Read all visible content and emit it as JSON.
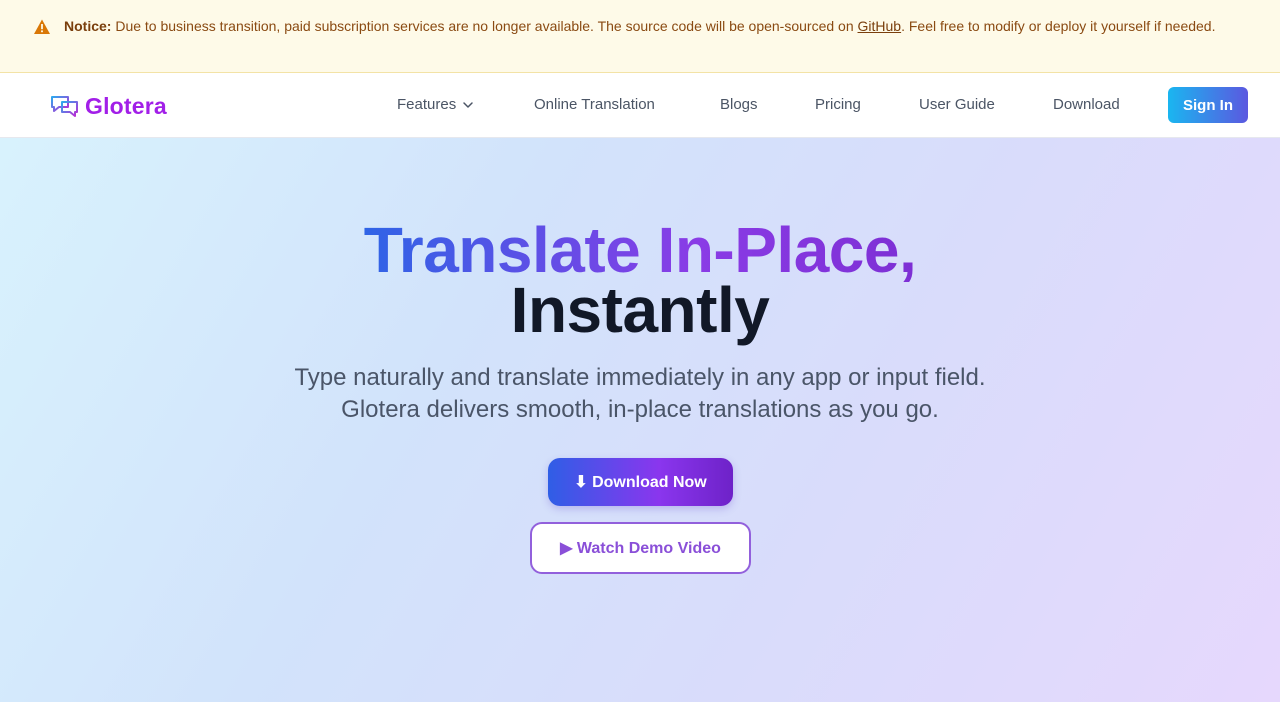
{
  "notice": {
    "icon": "warning-icon",
    "label": "Notice:",
    "text_before": " Due to business transition, paid subscription services are no longer available. The source code will be open-sourced on ",
    "link_text": "GitHub",
    "text_after": ". Feel free to modify or deploy it yourself if needed."
  },
  "header": {
    "logo": {
      "icon": "chat-bubbles-icon",
      "text": "Glotera"
    },
    "nav": {
      "features": "Features",
      "online_translation": "Online Translation",
      "blogs": "Blogs",
      "pricing": "Pricing",
      "user_guide": "User Guide",
      "download": "Download"
    },
    "signin": "Sign In"
  },
  "hero": {
    "title_line1": "Translate In-Place,",
    "title_line2": "Instantly",
    "subtitle_line1": "Type naturally and translate immediately in any app or input field.",
    "subtitle_line2": "Glotera delivers smooth, in-place translations as you go.",
    "download_button": "⬇ Download Now",
    "demo_button": "▶ Watch Demo Video"
  },
  "colors": {
    "notice_bg": "#fefae8",
    "notice_text": "#8a4a12",
    "brand_purple": "#a21fe8",
    "signin_gradient_start": "#1ab6f0",
    "signin_gradient_end": "#5b58e0",
    "title_gradient_start": "#2f64e6",
    "title_gradient_end": "#7d2fd4",
    "demo_border": "#9260dc"
  }
}
